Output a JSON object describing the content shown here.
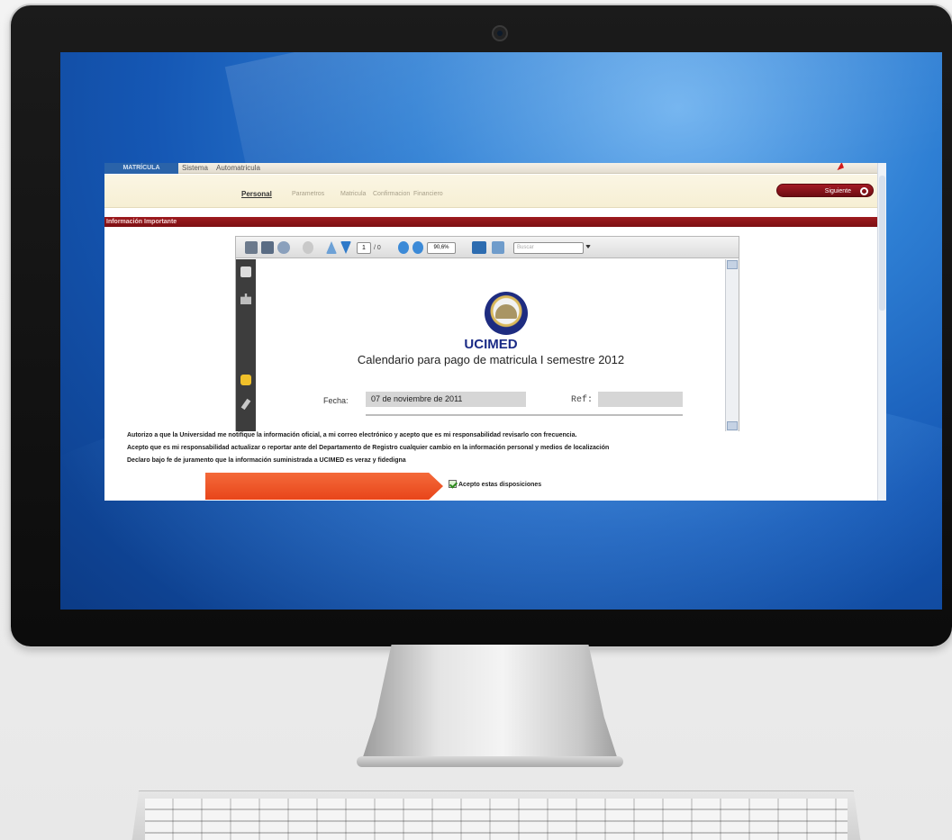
{
  "menubar": {
    "brand": "MATRÍCULA",
    "items": [
      "Sistema",
      "Automatricula"
    ]
  },
  "steps": {
    "personal": "Personal",
    "parametros": "Parametros",
    "matricula": "Matricula",
    "confirmacion": "Confirmacion",
    "financiero": "Financiero",
    "next_label": "Siguiente"
  },
  "info_header": "Información Importante",
  "pdf_toolbar": {
    "page_current": "1",
    "page_total": "/ 0",
    "zoom": "90,6%",
    "search_placeholder": "Buscar"
  },
  "document": {
    "institution": "UCIMED",
    "title": "Calendario para pago de matricula I semestre 2012",
    "fecha_label": "Fecha:",
    "fecha_value": "07 de noviembre de 2011",
    "ref_label": "Ref:"
  },
  "statements": [
    "Autorizo a que la Universidad me notifique la información oficial, a mi correo electrónico y acepto que es mi responsabilidad revisarlo con frecuencia.",
    "Acepto que es mi responsabilidad actualizar o reportar ante del Departamento de Registro cualquier cambio en la información personal y medios de localización",
    "Declaro bajo fe de juramento que la información suministrada a UCIMED es veraz y fidedigna"
  ],
  "accept_label": "Acepto estas disposiciones",
  "colors": {
    "brand_red": "#8b1a1f",
    "highlight_orange": "#f05a2a",
    "ucimed_blue": "#1a2b86"
  }
}
